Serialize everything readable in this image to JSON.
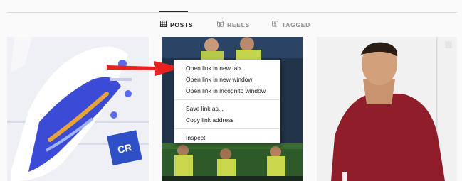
{
  "tabs": [
    {
      "label": "POSTS",
      "icon": "grid-icon",
      "active": true
    },
    {
      "label": "REELS",
      "icon": "reels-icon",
      "active": false
    },
    {
      "label": "TAGGED",
      "icon": "tagged-icon",
      "active": false
    }
  ],
  "posts": [
    {
      "image": "football-boot-photo"
    },
    {
      "image": "team-celebration-photo"
    },
    {
      "image": "player-portrait-photo"
    }
  ],
  "context_menu": {
    "items": [
      "Open link in new tab",
      "Open link in new window",
      "Open link in incognito window",
      "Save link as...",
      "Copy link address",
      "Inspect"
    ]
  },
  "colors": {
    "arrow": "#e8231f",
    "active_tab": "#262626",
    "inactive_tab": "#8e8e8e",
    "divider": "#dbdbdb"
  }
}
